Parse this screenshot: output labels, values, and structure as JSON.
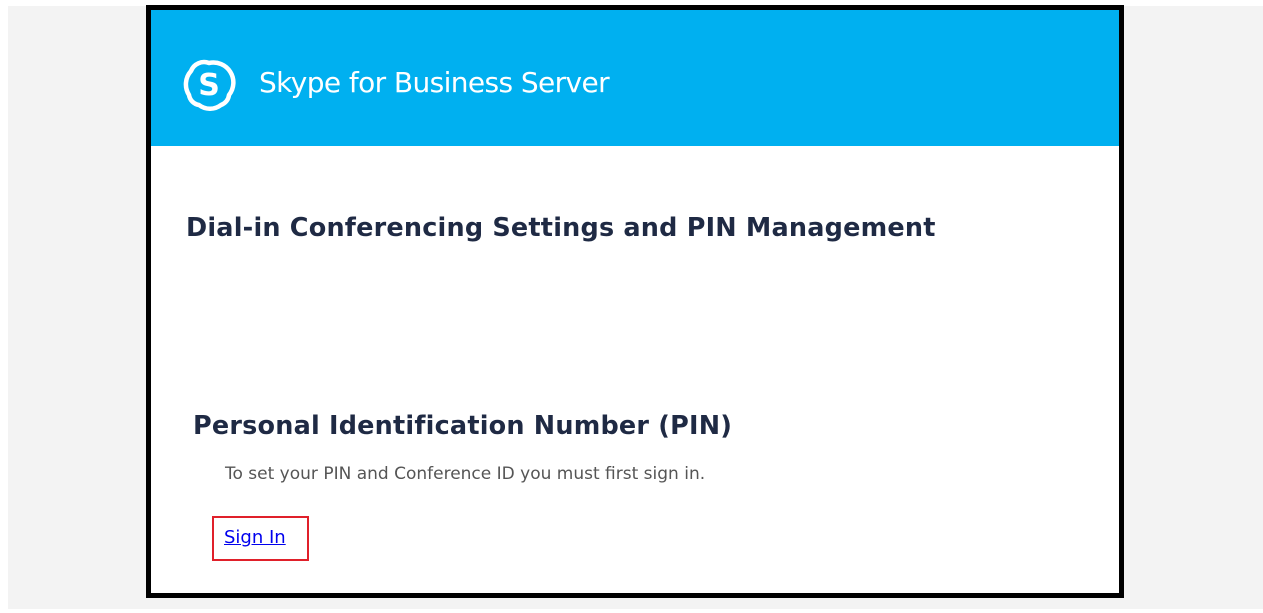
{
  "header": {
    "brand_name": "Skype for Business Server",
    "logo_icon": "skype-icon",
    "background_color": "#00b0f0"
  },
  "main": {
    "page_title": "Dial-in Conferencing Settings and PIN Management",
    "pin_section": {
      "title": "Personal Identification Number (PIN)",
      "instructions": "To set your PIN and Conference ID you must first sign in.",
      "sign_in_label": "Sign In"
    }
  },
  "highlight_color": "#e0202a",
  "link_color": "#0000ee"
}
